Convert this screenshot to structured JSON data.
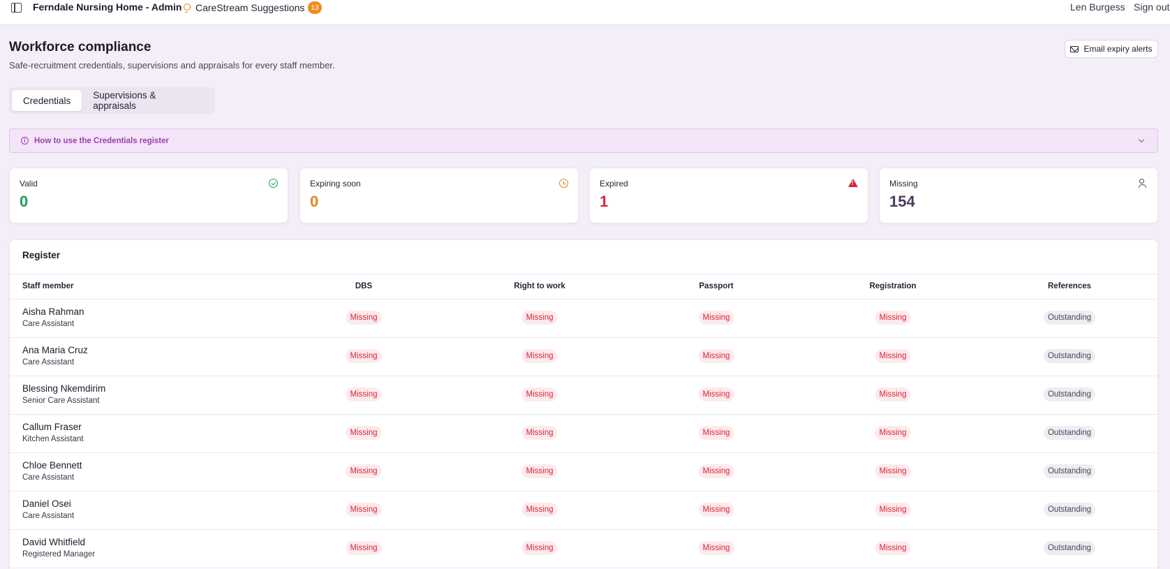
{
  "topbar": {
    "app_title": "Ferndale Nursing Home - Admin",
    "suggestions_label": "CareStream Suggestions",
    "suggestions_count": "13",
    "user_name": "Len Burgess",
    "sign_out": "Sign out"
  },
  "page": {
    "title": "Workforce compliance",
    "subtitle": "Safe-recruitment credentials, supervisions and appraisals for every staff member.",
    "email_button": "Email expiry alerts"
  },
  "tabs": [
    {
      "label": "Credentials",
      "active": true
    },
    {
      "label": "Supervisions & appraisals",
      "active": false
    }
  ],
  "howto": {
    "label": "How to use the Credentials register"
  },
  "stats": [
    {
      "label": "Valid",
      "value": "0",
      "color": "#1f9d55",
      "icon": "check-circle-icon"
    },
    {
      "label": "Expiring soon",
      "value": "0",
      "color": "#e5851b",
      "icon": "clock-icon"
    },
    {
      "label": "Expired",
      "value": "1",
      "color": "#d72638",
      "icon": "warning-triangle-icon"
    },
    {
      "label": "Missing",
      "value": "154",
      "color": "#4b3b5c",
      "icon": "users-icon"
    }
  ],
  "register": {
    "title": "Register",
    "columns": [
      "Staff member",
      "DBS",
      "Right to work",
      "Passport",
      "Registration",
      "References"
    ],
    "rows": [
      {
        "name": "Aisha Rahman",
        "role": "Care Assistant",
        "dbs": "Missing",
        "rtw": "Missing",
        "passport": "Missing",
        "registration": "Missing",
        "references": "Outstanding"
      },
      {
        "name": "Ana Maria Cruz",
        "role": "Care Assistant",
        "dbs": "Missing",
        "rtw": "Missing",
        "passport": "Missing",
        "registration": "Missing",
        "references": "Outstanding"
      },
      {
        "name": "Blessing Nkemdirim",
        "role": "Senior Care Assistant",
        "dbs": "Missing",
        "rtw": "Missing",
        "passport": "Missing",
        "registration": "Missing",
        "references": "Outstanding"
      },
      {
        "name": "Callum Fraser",
        "role": "Kitchen Assistant",
        "dbs": "Missing",
        "rtw": "Missing",
        "passport": "Missing",
        "registration": "Missing",
        "references": "Outstanding"
      },
      {
        "name": "Chloe Bennett",
        "role": "Care Assistant",
        "dbs": "Missing",
        "rtw": "Missing",
        "passport": "Missing",
        "registration": "Missing",
        "references": "Outstanding"
      },
      {
        "name": "Daniel Osei",
        "role": "Care Assistant",
        "dbs": "Missing",
        "rtw": "Missing",
        "passport": "Missing",
        "registration": "Missing",
        "references": "Outstanding"
      },
      {
        "name": "David Whitfield",
        "role": "Registered Manager",
        "dbs": "Missing",
        "rtw": "Missing",
        "passport": "Missing",
        "registration": "Missing",
        "references": "Outstanding"
      }
    ]
  }
}
